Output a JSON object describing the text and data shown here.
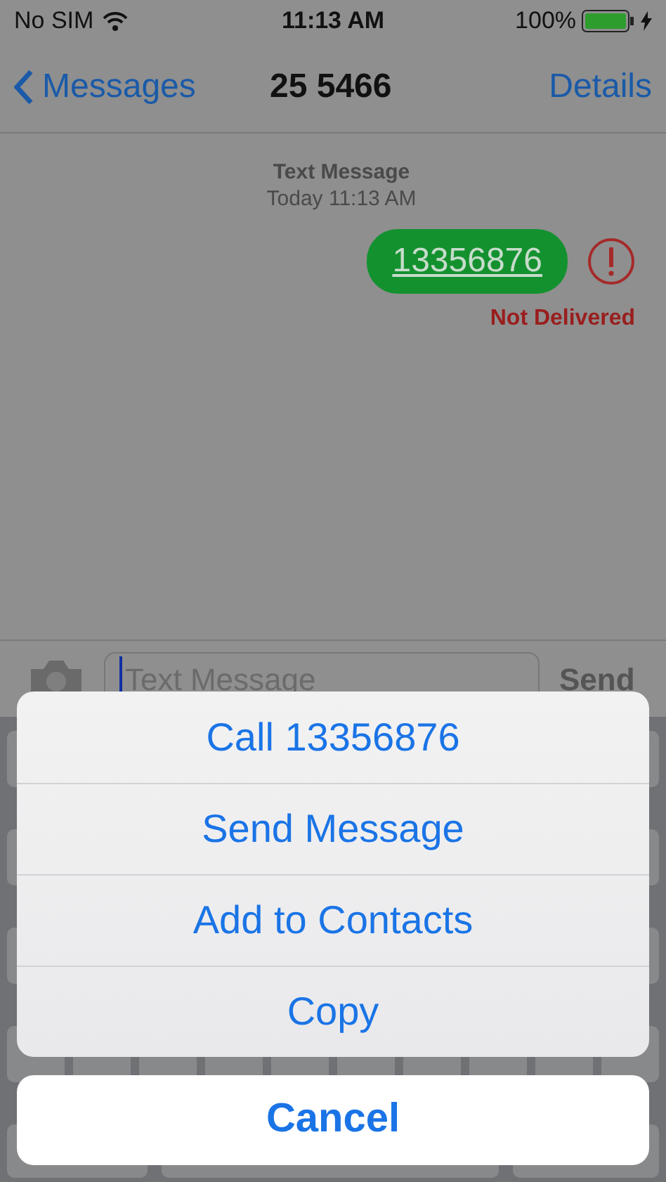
{
  "status_bar": {
    "carrier": "No SIM",
    "time": "11:13 AM",
    "battery": "100%",
    "charging": true
  },
  "nav": {
    "back": "Messages",
    "title": "25 5466",
    "action": "Details"
  },
  "thread": {
    "header": "Text Message",
    "timestamp": "Today 11:13 AM",
    "messages": [
      {
        "text": "13356876",
        "outgoing": true,
        "delivered": false,
        "status": "Not Delivered"
      }
    ]
  },
  "composer": {
    "placeholder": "Text Message",
    "send": "Send"
  },
  "action_sheet": {
    "actions": [
      "Call 13356876",
      "Send Message",
      "Add to Contacts",
      "Copy"
    ],
    "cancel": "Cancel"
  }
}
